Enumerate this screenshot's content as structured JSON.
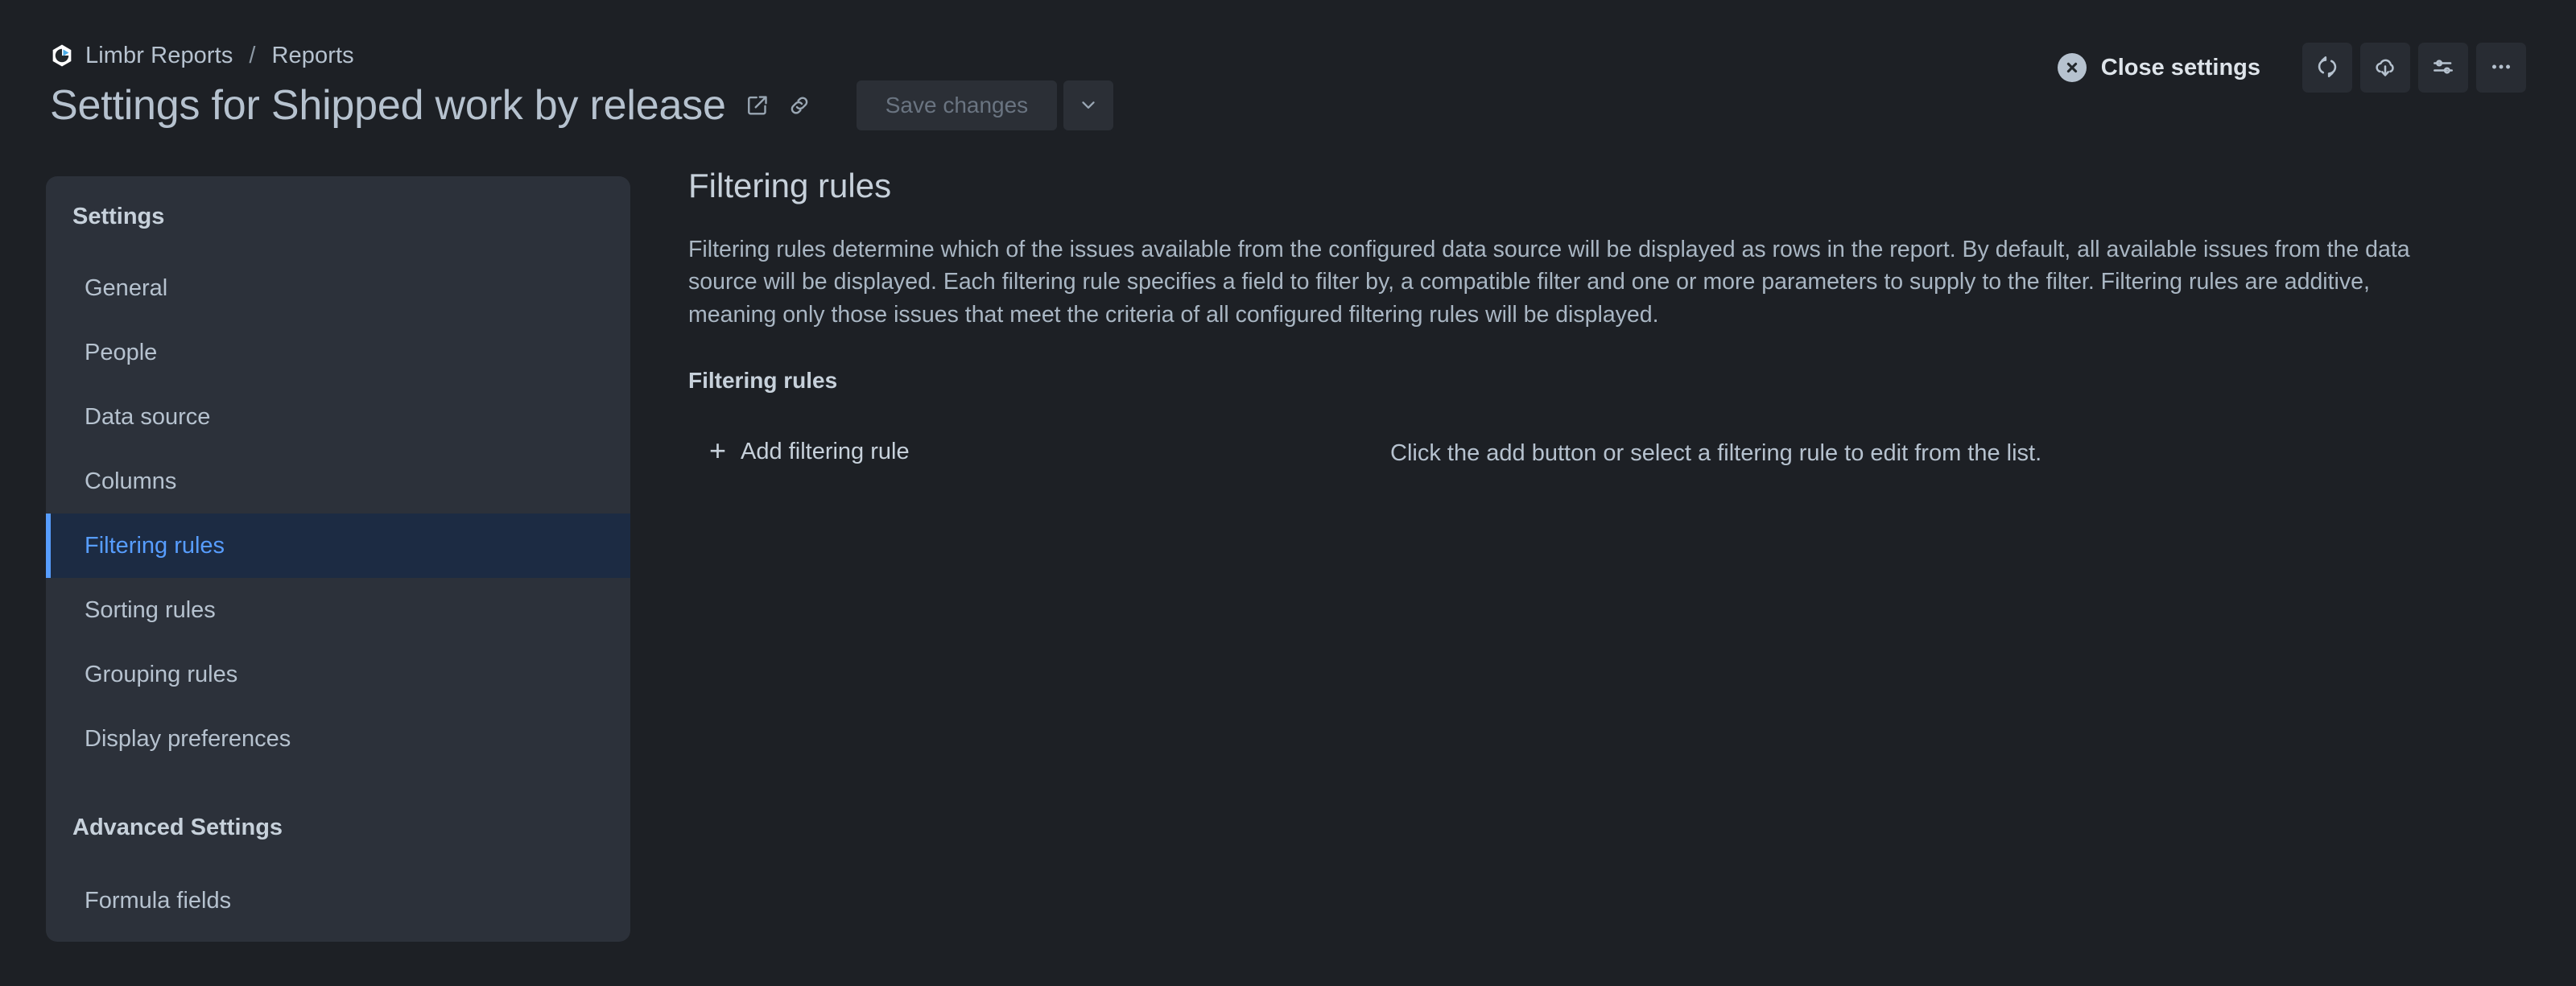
{
  "header": {
    "logo_icon": "limbr-hexagon-play-logo",
    "breadcrumb": {
      "root": "Limbr Reports",
      "separator": "/",
      "current": "Reports"
    },
    "title": "Settings for Shipped work by release",
    "title_icons": [
      {
        "icon": "external-link-icon"
      },
      {
        "icon": "link-icon"
      }
    ],
    "save_label": "Save changes",
    "save_disabled": true,
    "save_caret_icon": "chevron-down-icon",
    "close_settings_label": "Close settings",
    "close_settings_icon": "close-circle-icon",
    "actions": [
      {
        "icon": "refresh-sync-icon",
        "name": "refresh-button"
      },
      {
        "icon": "cloud-download-icon",
        "name": "download-button"
      },
      {
        "icon": "sliders-icon",
        "name": "display-settings-button"
      },
      {
        "icon": "more-horizontal-icon",
        "name": "more-actions-button"
      }
    ]
  },
  "sidebar": {
    "group_title": "Settings",
    "items": [
      {
        "label": "General",
        "active": false
      },
      {
        "label": "People",
        "active": false
      },
      {
        "label": "Data source",
        "active": false
      },
      {
        "label": "Columns",
        "active": false
      },
      {
        "label": "Filtering rules",
        "active": true
      },
      {
        "label": "Sorting rules",
        "active": false
      },
      {
        "label": "Grouping rules",
        "active": false
      },
      {
        "label": "Display preferences",
        "active": false
      }
    ],
    "advanced_title": "Advanced Settings",
    "advanced_items": [
      {
        "label": "Formula fields",
        "active": false
      }
    ]
  },
  "main": {
    "heading": "Filtering rules",
    "description": "Filtering rules determine which of the issues available from the configured data source will be displayed as rows in the report. By default, all available issues from the data source will be displayed. Each filtering rule specifies a field to filter by, a compatible filter and one or more parameters to supply to the filter. Filtering rules are additive, meaning only those issues that meet the criteria of all configured filtering rules will be displayed.",
    "section_label": "Filtering rules",
    "add_rule_label": "Add filtering rule",
    "add_rule_icon": "plus-icon",
    "empty_hint": "Click the add button or select a filtering rule to edit from the list."
  },
  "colors": {
    "page_background": "#1d2025",
    "panel_background": "#2c313a",
    "accent_blue": "#579dff",
    "active_item_background": "#1c2b43",
    "text_primary": "#c7d1db",
    "text_secondary": "#b6c2cf",
    "text_disabled": "#6a7481",
    "button_background": "#2b2f36",
    "logo_accent": "#4bade8"
  }
}
